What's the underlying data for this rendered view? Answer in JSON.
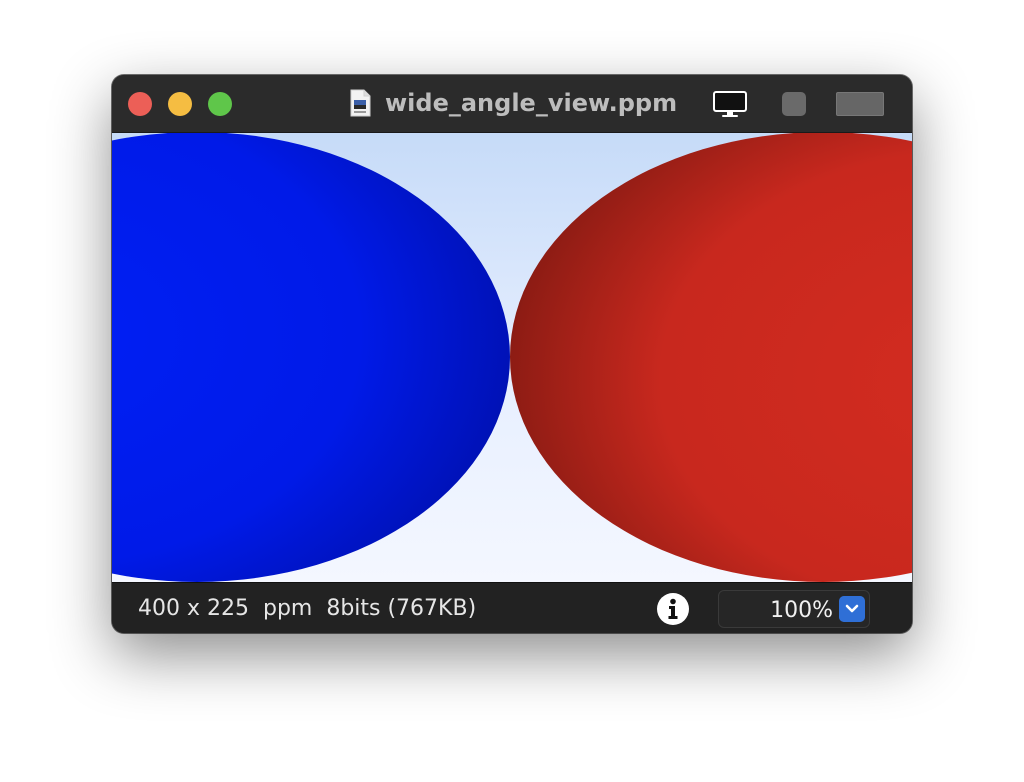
{
  "window": {
    "title": "wide_angle_view.ppm"
  },
  "titlebar": {
    "buttons": {
      "close": "close-button",
      "minimize": "minimize-button",
      "zoom": "zoom-button"
    },
    "file_icon": "document-icon",
    "display_icon": "monitor-icon"
  },
  "image": {
    "description_colors": {
      "left_sphere": "#0019ee",
      "right_sphere": "#c42a1f",
      "sky_top": "#c6dbf8",
      "sky_bottom": "#f4f7ff"
    }
  },
  "status": {
    "info": "400 x 225  ppm  8bits (767KB)",
    "zoom": "100%"
  },
  "colors": {
    "accent": "#2f6fd6",
    "titlebar": "#2b2b2b",
    "statusbar": "#222222"
  }
}
